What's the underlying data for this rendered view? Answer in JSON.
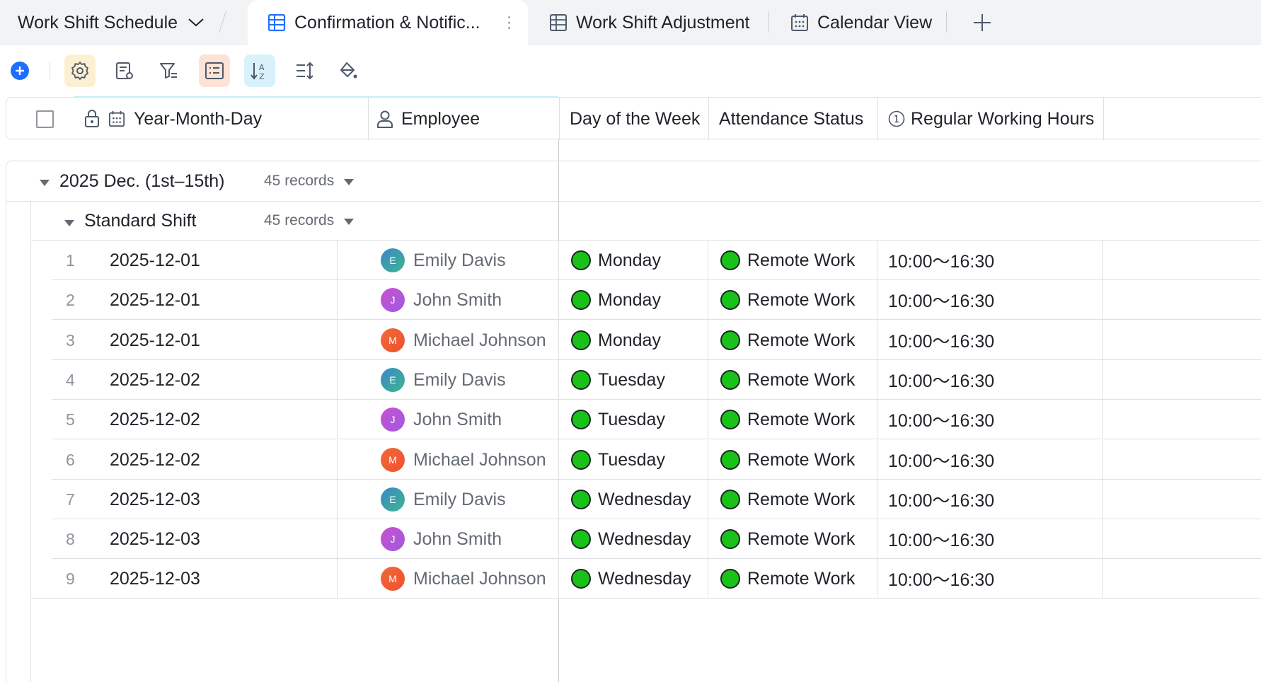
{
  "tabs": {
    "base_title": "Work Shift Schedule",
    "items": [
      {
        "label": "Confirmation & Notific..."
      },
      {
        "label": "Work Shift Adjustment"
      },
      {
        "label": "Calendar View"
      }
    ]
  },
  "columns": [
    {
      "label": "Year-Month-Day"
    },
    {
      "label": "Employee"
    },
    {
      "label": "Day of the Week"
    },
    {
      "label": "Attendance Status"
    },
    {
      "label": "Regular Working Hours"
    }
  ],
  "groups": {
    "outer": {
      "label": "2025 Dec. (1st–15th)",
      "count": "45 records"
    },
    "inner": {
      "label": "Standard Shift",
      "count": "45 records"
    }
  },
  "rows": [
    {
      "index": "1",
      "date": "2025-12-01",
      "employee": "Emily Davis",
      "initial": "E",
      "day": "Monday",
      "status": "Remote Work",
      "hours": "10:00～16:30"
    },
    {
      "index": "2",
      "date": "2025-12-01",
      "employee": "John Smith",
      "initial": "J",
      "day": "Monday",
      "status": "Remote Work",
      "hours": "10:00～16:30"
    },
    {
      "index": "3",
      "date": "2025-12-01",
      "employee": "Michael Johnson",
      "initial": "M",
      "day": "Monday",
      "status": "Remote Work",
      "hours": "10:00～16:30"
    },
    {
      "index": "4",
      "date": "2025-12-02",
      "employee": "Emily Davis",
      "initial": "E",
      "day": "Tuesday",
      "status": "Remote Work",
      "hours": "10:00～16:30"
    },
    {
      "index": "5",
      "date": "2025-12-02",
      "employee": "John Smith",
      "initial": "J",
      "day": "Tuesday",
      "status": "Remote Work",
      "hours": "10:00～16:30"
    },
    {
      "index": "6",
      "date": "2025-12-02",
      "employee": "Michael Johnson",
      "initial": "M",
      "day": "Tuesday",
      "status": "Remote Work",
      "hours": "10:00～16:30"
    },
    {
      "index": "7",
      "date": "2025-12-03",
      "employee": "Emily Davis",
      "initial": "E",
      "day": "Wednesday",
      "status": "Remote Work",
      "hours": "10:00～16:30"
    },
    {
      "index": "8",
      "date": "2025-12-03",
      "employee": "John Smith",
      "initial": "J",
      "day": "Wednesday",
      "status": "Remote Work",
      "hours": "10:00～16:30"
    },
    {
      "index": "9",
      "date": "2025-12-03",
      "employee": "Michael Johnson",
      "initial": "M",
      "day": "Wednesday",
      "status": "Remote Work",
      "hours": "10:00～16:30"
    }
  ],
  "colors": {
    "status_green": "#19c219",
    "accent_blue": "#1f6fff",
    "avatar_emily": "#3a86c8",
    "avatar_john": "#c94fd0",
    "avatar_michael": "#ef6a3a"
  },
  "icons": {
    "add": "plus-circle-icon",
    "settings": "gear-icon",
    "fields": "field-settings-icon",
    "filter": "filter-icon",
    "group": "group-list-icon",
    "sort": "sort-icon",
    "row_height": "row-height-icon",
    "fill": "paint-bucket-icon"
  }
}
